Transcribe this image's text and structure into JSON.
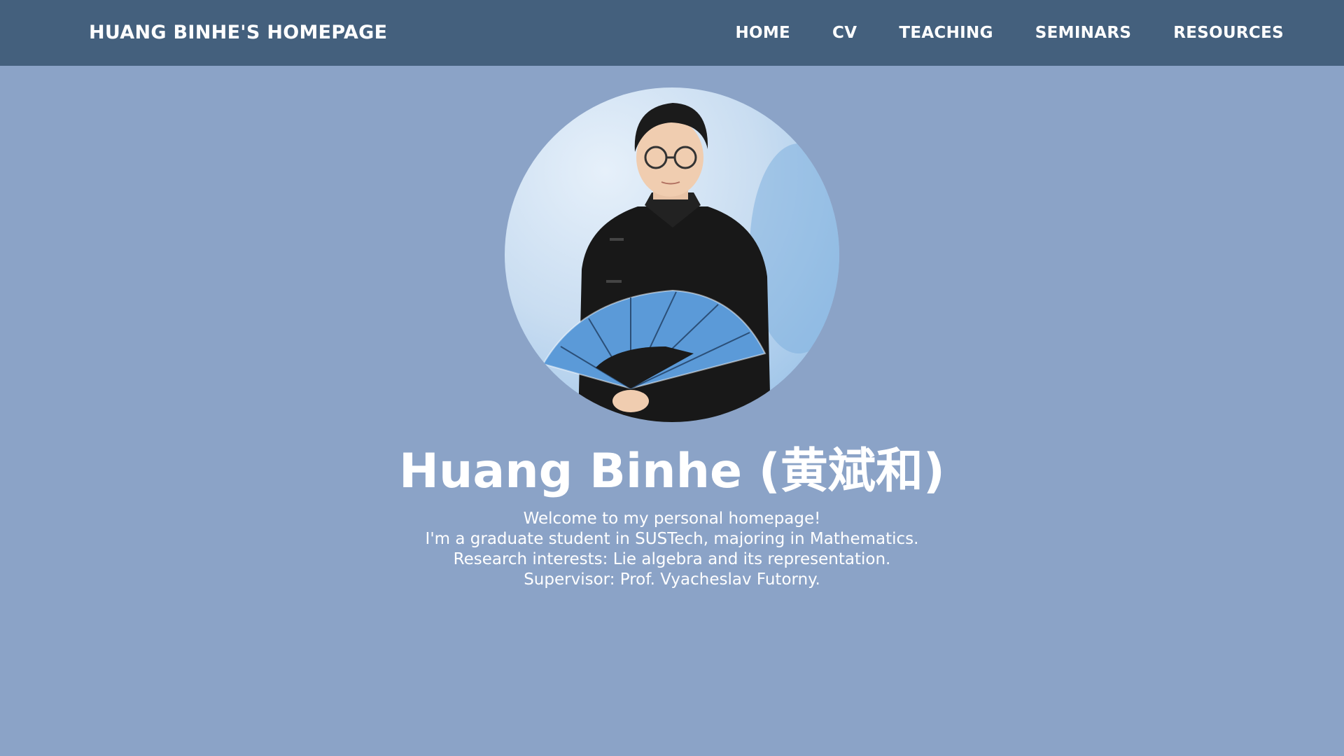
{
  "navbar": {
    "brand": "HUANG BINHE'S HOMEPAGE",
    "links": [
      "HOME",
      "CV",
      "TEACHING",
      "SEMINARS",
      "RESOURCES"
    ]
  },
  "profile": {
    "photo_icon": "profile-photo",
    "name": "Huang Binhe (黄斌和)",
    "bio_lines": [
      "Welcome to my personal homepage!",
      "I'm a graduate student in SUSTech, majoring in Mathematics.",
      "Research interests: Lie algebra and its representation.",
      "Supervisor: Prof. Vyacheslav Futorny."
    ]
  },
  "colors": {
    "navbar": "#44607d",
    "background": "#8ba3c7",
    "text": "#ffffff",
    "fan": "#5b9ad8"
  }
}
